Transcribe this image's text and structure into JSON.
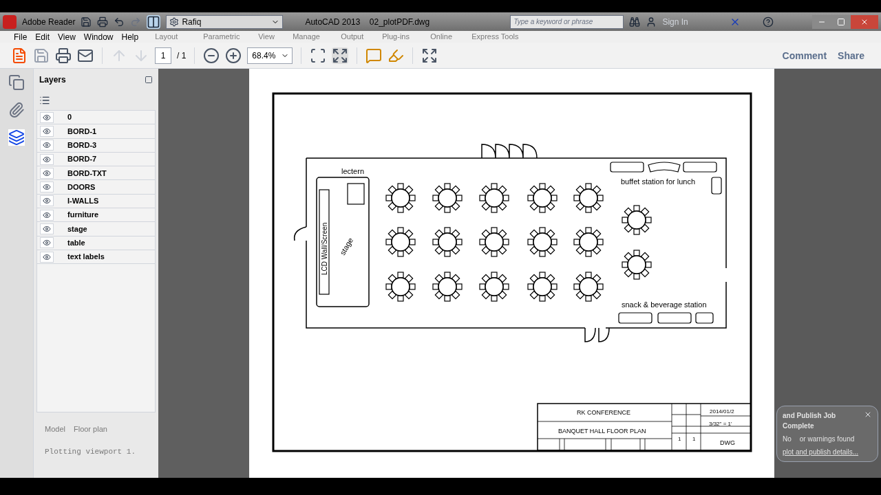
{
  "title_bar": {
    "app": "Adobe Reader",
    "workspace": "Rafiq",
    "document_title": "AutoCAD 2013    02_plotPDF.dwg",
    "search": {
      "placeholder": "Type a keyword or phrase"
    },
    "sign_in": "Sign In"
  },
  "menu": [
    "File",
    "Edit",
    "View",
    "Window",
    "Help"
  ],
  "ribbon_tabs": [
    "Layout",
    "Parametric",
    "View",
    "Manage",
    "Output",
    "Plug-ins",
    "Online",
    "Express Tools"
  ],
  "toolbar": {
    "page": "1",
    "page_total": "/ 1",
    "zoom": "68.4%",
    "actions": [
      "Comment",
      "Share"
    ]
  },
  "layers_panel": {
    "title": "Layers",
    "layers": [
      {
        "name": "0",
        "visible": true
      },
      {
        "name": "BORD-1",
        "visible": true
      },
      {
        "name": "BORD-3",
        "visible": true
      },
      {
        "name": "BORD-7",
        "visible": true
      },
      {
        "name": "BORD-TXT",
        "visible": true
      },
      {
        "name": "DOORS",
        "visible": true
      },
      {
        "name": "I-WALLS",
        "visible": true
      },
      {
        "name": "furniture",
        "visible": true
      },
      {
        "name": "stage",
        "visible": true
      },
      {
        "name": "table",
        "visible": true
      },
      {
        "name": "text labels",
        "visible": true
      }
    ]
  },
  "autocad_overlay": {
    "layout_tabs": [
      "Model",
      "Floor plan"
    ],
    "command_line": "Plotting viewport 1."
  },
  "drawing": {
    "lectern": "lectern",
    "buffet": "buffet station for lunch",
    "snack": "snack & beverage station",
    "screen": "LCD Wall/Screen",
    "stage": "stage"
  },
  "title_block": {
    "project": "RK CONFERENCE",
    "title": "BANQUET HALL FLOOR PLAN",
    "date": "2014/01/2",
    "scale": "3/32\" = 1'",
    "sheet": "1",
    "of": "1",
    "drawing": "DWG"
  },
  "notification": {
    "title": "and Publish Job Complete",
    "message_start": "No",
    "message_end": "or warnings found",
    "link": "plot and publish details..."
  }
}
